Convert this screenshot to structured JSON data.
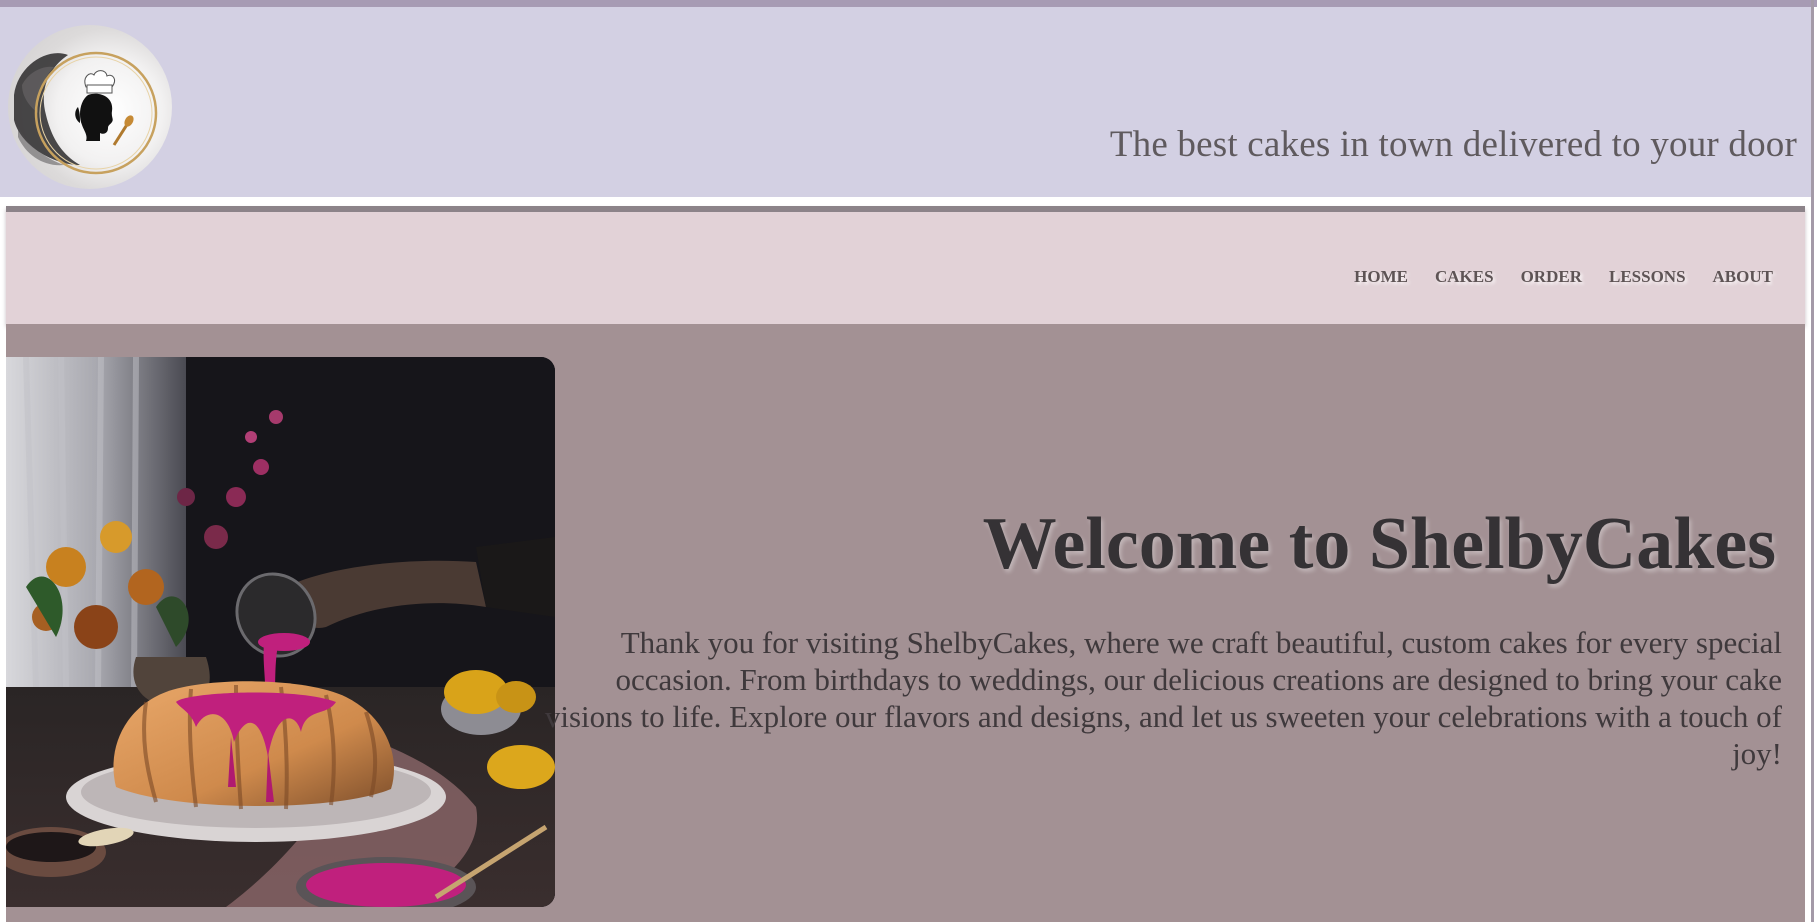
{
  "header": {
    "logo_icon": "chef-silhouette-logo-icon",
    "tagline": "The best cakes in town delivered to your door"
  },
  "nav": {
    "items": [
      {
        "label": "HOME"
      },
      {
        "label": "CAKES"
      },
      {
        "label": "ORDER"
      },
      {
        "label": "LESSONS"
      },
      {
        "label": "ABOUT"
      }
    ]
  },
  "main": {
    "image_icon": "bundt-cake-photo",
    "title": "Welcome to ShelbyCakes",
    "intro": "Thank you for visiting ShelbyCakes, where we craft beautiful, custom cakes for every special occasion. From birthdays to weddings, our delicious creations are designed to bring your cake visions to life. Explore our flavors and designs, and let us sweeten your celebrations with a touch of joy!"
  },
  "colors": {
    "header_bg": "#d3d0e3",
    "nav_bg": "#e2d2d7",
    "main_bg": "#a39194",
    "title_text": "#353235",
    "glaze_accent": "#c0207d"
  }
}
